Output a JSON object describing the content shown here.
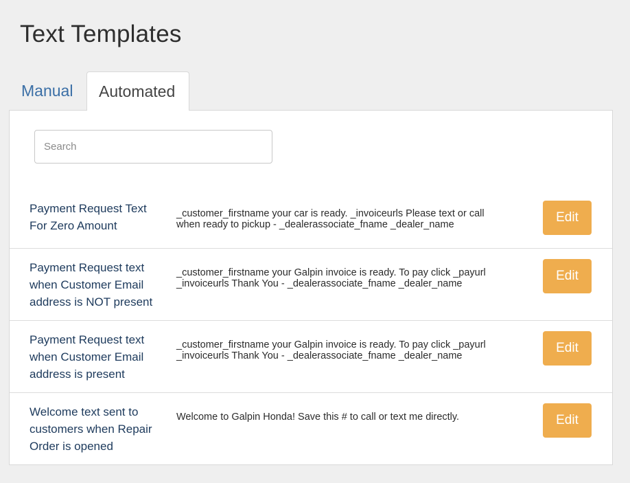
{
  "page": {
    "title": "Text Templates"
  },
  "tabs": [
    {
      "label": "Manual",
      "active": false
    },
    {
      "label": "Automated",
      "active": true
    }
  ],
  "search": {
    "placeholder": "Search",
    "value": ""
  },
  "templates": [
    {
      "title": "Payment Request Text For Zero Amount",
      "text": "_customer_firstname your car is ready. _invoiceurls Please text or call when ready to pickup - _dealerassociate_fname _dealer_name",
      "edit_label": "Edit"
    },
    {
      "title": "Payment Request text when Customer Email address is NOT present",
      "text": "_customer_firstname your Galpin invoice is ready. To pay click _payurl _invoiceurls Thank You - _dealerassociate_fname _dealer_name",
      "edit_label": "Edit"
    },
    {
      "title": "Payment Request text when Customer Email address is present",
      "text": "_customer_firstname your Galpin invoice is ready. To pay click _payurl _invoiceurls Thank You - _dealerassociate_fname _dealer_name",
      "edit_label": "Edit"
    },
    {
      "title": "Welcome text sent to customers when Repair Order is opened",
      "text": "Welcome to Galpin Honda! Save this # to call or text me directly.",
      "edit_label": "Edit"
    }
  ],
  "colors": {
    "background": "#efefef",
    "link": "#3b6fa6",
    "title_text": "#1d3a5c",
    "edit_button": "#efad4e"
  }
}
